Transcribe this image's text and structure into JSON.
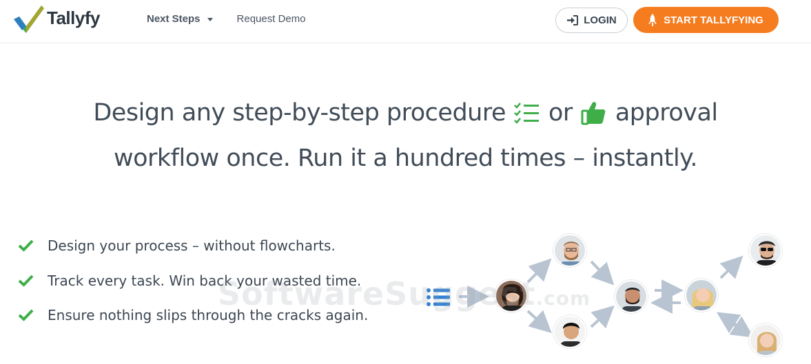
{
  "header": {
    "logo_text": "Tallyfy",
    "nav": [
      {
        "label": "Next Steps",
        "has_dropdown": true
      },
      {
        "label": "Request Demo",
        "has_dropdown": false
      }
    ],
    "login_label": "LOGIN",
    "start_label": "START TALLYFYING"
  },
  "hero": {
    "line1_part1": "Design any step-by-step procedure",
    "line1_part2": "or",
    "line1_part3": "approval",
    "line2": "workflow once. Run it a hundred times – instantly."
  },
  "features": [
    "Design your process – without flowcharts.",
    "Track every task. Win back your wasted time.",
    "Ensure nothing slips through the cracks again."
  ],
  "watermark": {
    "main": "SoftwareSuggest",
    "suffix": ".com"
  },
  "colors": {
    "accent_orange": "#f57c1f",
    "check_green": "#3fae49",
    "list_blue": "#2f80d6",
    "arrow_gray": "#b8c4d2"
  }
}
